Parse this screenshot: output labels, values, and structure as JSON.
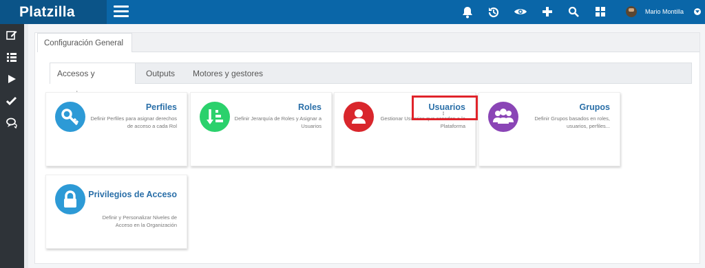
{
  "app": {
    "brand": "Platzilla"
  },
  "user": {
    "name": "Mario Montilla"
  },
  "header_icons": [
    "bell-icon",
    "history-icon",
    "eye-icon",
    "plus-icon",
    "search-icon",
    "grid-icon"
  ],
  "rail_icons": [
    "edit-icon",
    "list-icon",
    "play-icon",
    "check-icon",
    "chat-icon"
  ],
  "main_tab": {
    "label": "Configuración General"
  },
  "subtabs": [
    {
      "label": "Accesos y permisos",
      "active": true
    },
    {
      "label": "Outputs"
    },
    {
      "label": "Motores y gestores"
    }
  ],
  "cards": [
    {
      "title": "Perfiles",
      "description": "Definir Perfiles para asignar derechos de acceso a cada Rol",
      "icon": "key-icon",
      "color": "#2d9ad6"
    },
    {
      "title": "Roles",
      "description": "Definir Jerarquía de Roles y Asignar a Usuarios",
      "icon": "sort-list-icon",
      "color": "#2bd16c"
    },
    {
      "title": "Usuarios",
      "description": "Gestionar Usuarios que acceden a la Plataforma",
      "icon": "user-icon",
      "color": "#d9262c"
    },
    {
      "title": "Grupos",
      "description": "Definir Grupos basados en roles, usuarios, perfiles...",
      "icon": "group-icon",
      "color": "#8a45b6"
    },
    {
      "title": "Privilegios de Acceso",
      "description": "Definir y Personalizar Niveles de Acceso en la Organización",
      "icon": "lock-icon",
      "color": "#2d9ad6"
    }
  ],
  "colors": {
    "topbar": "#0a66a8",
    "rail": "#2e3338",
    "link": "#2a6fa8",
    "highlight": "#e0232a"
  }
}
